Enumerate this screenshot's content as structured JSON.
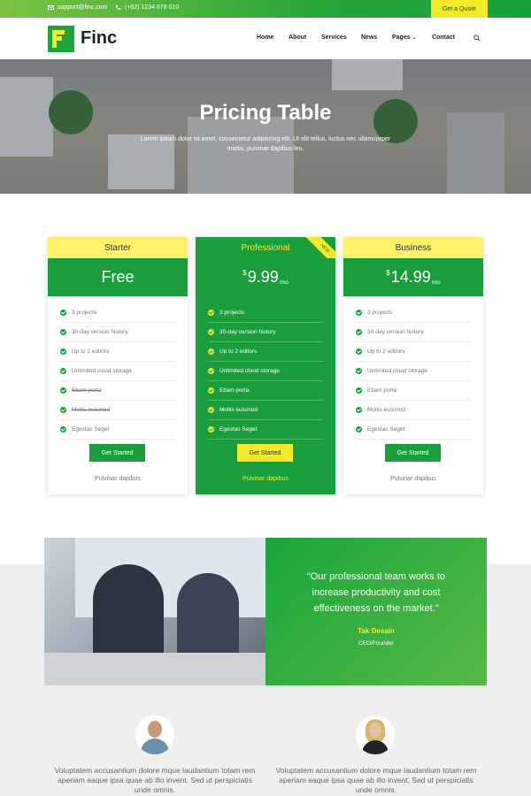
{
  "topbar": {
    "email": "support@finc.com",
    "phone": "(+62) 1234 678 010",
    "quote_button": "Get a Quote"
  },
  "header": {
    "brand": "Finc",
    "nav": [
      "Home",
      "About",
      "Services",
      "News",
      "Pages",
      "Contact"
    ]
  },
  "hero": {
    "title": "Pricing Table",
    "subtitle": "Lorem ipsum dolor sit amet, consectetur adipiscing elit. Ut elit tellus, luctus nec ullamcorper mattis, pulvinar dapibus leo."
  },
  "plans": [
    {
      "name": "Starter",
      "price": "Free",
      "features": [
        "3 projects",
        "30-day version history",
        "Up to 2 editors",
        "Unlimited cloud storage",
        "Etiam porta",
        "Mollis euismod",
        "Egestas Seget"
      ],
      "button": "Get Started",
      "footer": "Pulvinar dapibus"
    },
    {
      "name": "Professional",
      "currency": "$",
      "amount": "9.99",
      "period": "/mo",
      "badge": "NEW",
      "features": [
        "3 projects",
        "30-day version history",
        "Up to 2 editors",
        "Unlimited cloud storage",
        "Etiam porta",
        "Mollis euismod",
        "Egestas Seget"
      ],
      "button": "Get Started",
      "footer": "Pulvinar dapibus"
    },
    {
      "name": "Business",
      "currency": "$",
      "amount": "14.99",
      "period": "/mo",
      "features": [
        "3 projects",
        "30-day version history",
        "Up to 2 editors",
        "Unlimited cloud storage",
        "Etiam porta",
        "Mollis euismod",
        "Egestas Seget"
      ],
      "button": "Get Started",
      "footer": "Pulvinar dapibus"
    }
  ],
  "testimonial": {
    "quote": "“Our professional team works to increase productivity and cost effectiveness on the market.”",
    "name": "Tak Desain",
    "role": "CEO/Founder"
  },
  "reviews": [
    {
      "text": "Voluptatem accusantium dolore mque laudantium totam rem aperiam eaque ipsa quae ab illo invent. Sed ut perspiciatis unde omnis."
    },
    {
      "text": "Voluptatem accusantium dolore mque laudantium totam rem aperiam eaque ipsa quae ab illo invent. Sed ut perspiciatis unde omnis."
    }
  ],
  "colors": {
    "green": "#1a9d3c",
    "yellow": "#f5e92c",
    "light_yellow": "#fff16a"
  }
}
